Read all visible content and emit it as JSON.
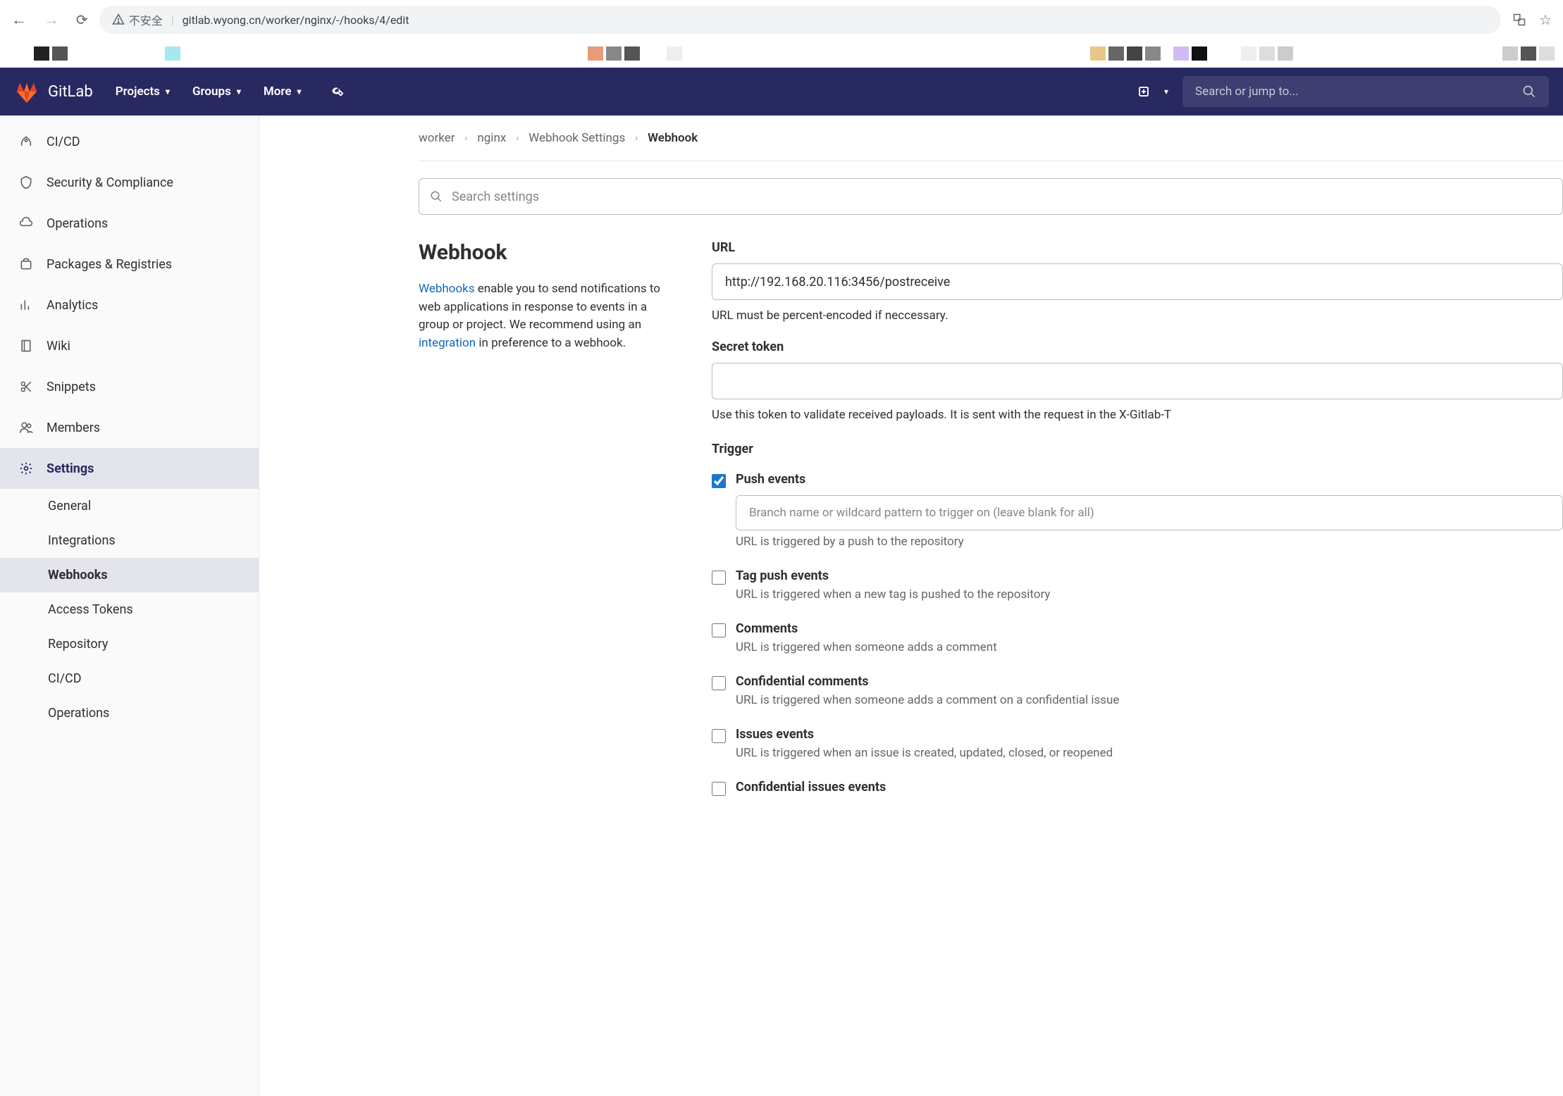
{
  "browser": {
    "insecure_label": "不安全",
    "url": "gitlab.wyong.cn/worker/nginx/-/hooks/4/edit"
  },
  "header": {
    "brand": "GitLab",
    "nav": {
      "projects": "Projects",
      "groups": "Groups",
      "more": "More"
    },
    "search_placeholder": "Search or jump to..."
  },
  "sidebar": {
    "items": [
      {
        "label": "CI/CD"
      },
      {
        "label": "Security & Compliance"
      },
      {
        "label": "Operations"
      },
      {
        "label": "Packages & Registries"
      },
      {
        "label": "Analytics"
      },
      {
        "label": "Wiki"
      },
      {
        "label": "Snippets"
      },
      {
        "label": "Members"
      },
      {
        "label": "Settings"
      }
    ],
    "subitems": [
      {
        "label": "General"
      },
      {
        "label": "Integrations"
      },
      {
        "label": "Webhooks"
      },
      {
        "label": "Access Tokens"
      },
      {
        "label": "Repository"
      },
      {
        "label": "CI/CD"
      },
      {
        "label": "Operations"
      }
    ]
  },
  "breadcrumbs": {
    "b0": "worker",
    "b1": "nginx",
    "b2": "Webhook Settings",
    "b3": "Webhook"
  },
  "search_settings_placeholder": "Search settings",
  "webhook": {
    "heading": "Webhook",
    "desc_link1": "Webhooks",
    "desc_part1": " enable you to send notifications to web applications in response to events in a group or project. We recommend using an ",
    "desc_link2": "integration",
    "desc_part2": " in preference to a webhook."
  },
  "form": {
    "url_label": "URL",
    "url_value": "http://192.168.20.116:3456/postreceive",
    "url_help": "URL must be percent-encoded if neccessary.",
    "token_label": "Secret token",
    "token_help": "Use this token to validate received payloads. It is sent with the request in the X-Gitlab-T",
    "trigger_label": "Trigger",
    "triggers": [
      {
        "title": "Push events",
        "checked": true,
        "branch_placeholder": "Branch name or wildcard pattern to trigger on (leave blank for all)",
        "desc": "URL is triggered by a push to the repository"
      },
      {
        "title": "Tag push events",
        "checked": false,
        "desc": "URL is triggered when a new tag is pushed to the repository"
      },
      {
        "title": "Comments",
        "checked": false,
        "desc": "URL is triggered when someone adds a comment"
      },
      {
        "title": "Confidential comments",
        "checked": false,
        "desc": "URL is triggered when someone adds a comment on a confidential issue"
      },
      {
        "title": "Issues events",
        "checked": false,
        "desc": "URL is triggered when an issue is created, updated, closed, or reopened"
      },
      {
        "title": "Confidential issues events",
        "checked": false,
        "desc": ""
      }
    ]
  }
}
